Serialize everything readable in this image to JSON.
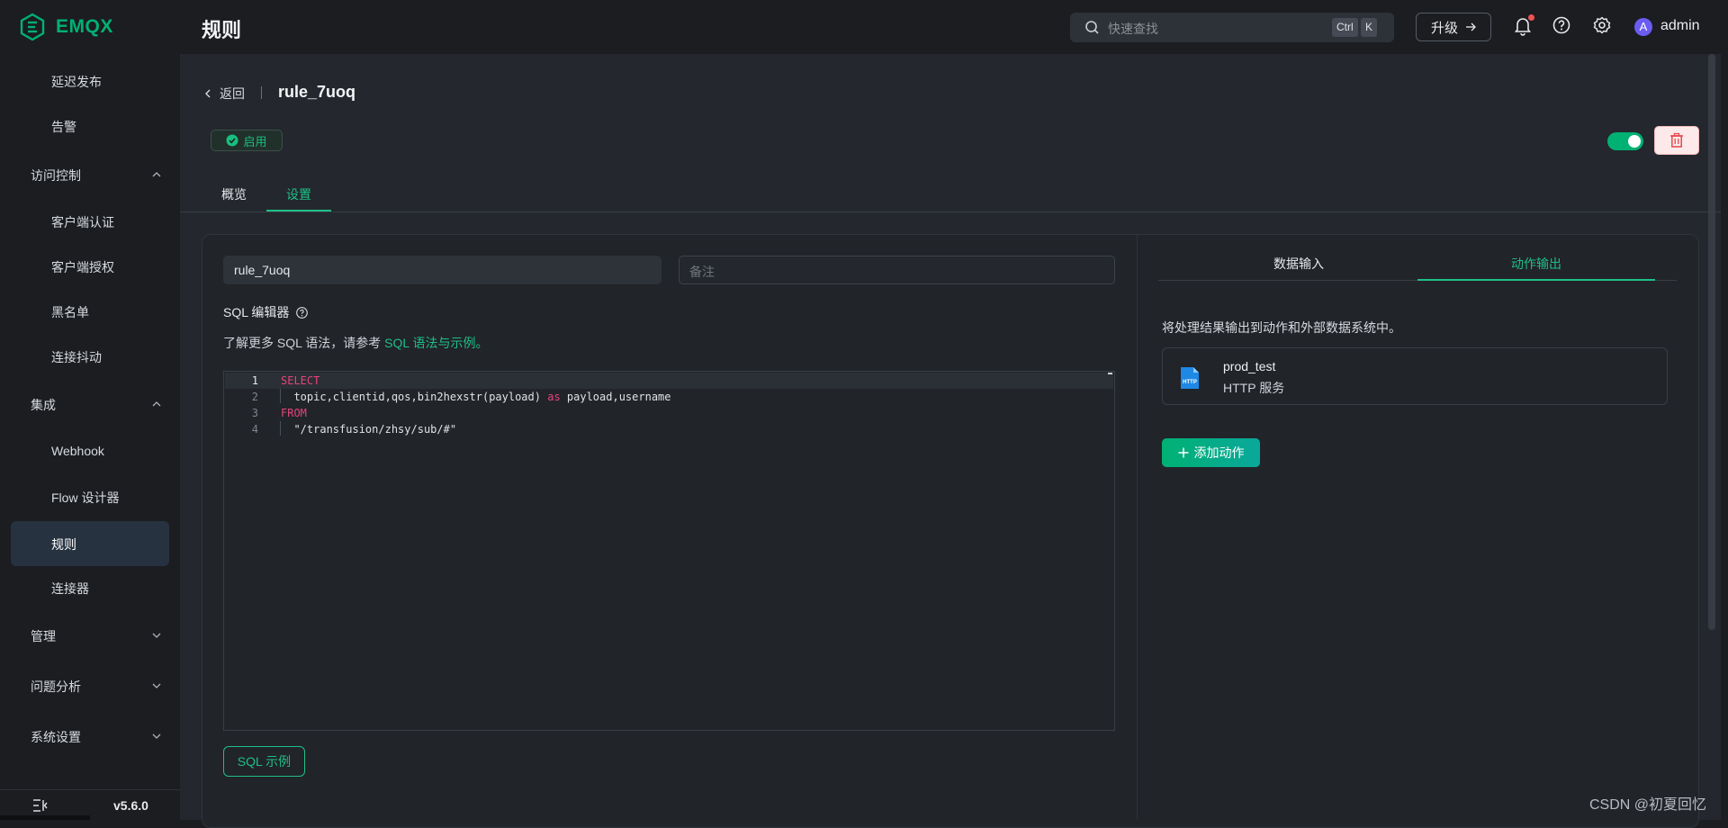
{
  "header": {
    "logo_text": "EMQX",
    "page_title": "规则",
    "search": {
      "placeholder": "快速查找",
      "shortcut_ctrl": "Ctrl",
      "shortcut_key": "K"
    },
    "upgrade_label": "升级",
    "user": {
      "avatar_letter": "A",
      "name": "admin"
    },
    "icons": [
      "search-icon",
      "arrow-right-icon",
      "bell-icon",
      "help-icon",
      "gear-icon"
    ]
  },
  "sidebar": {
    "items": [
      {
        "label": "延迟发布",
        "level": "sub"
      },
      {
        "label": "告警",
        "level": "sub"
      },
      {
        "label": "访问控制",
        "level": "group",
        "expanded": true
      },
      {
        "label": "客户端认证",
        "level": "sub"
      },
      {
        "label": "客户端授权",
        "level": "sub"
      },
      {
        "label": "黑名单",
        "level": "sub"
      },
      {
        "label": "连接抖动",
        "level": "sub"
      },
      {
        "label": "集成",
        "level": "group",
        "expanded": true
      },
      {
        "label": "Webhook",
        "level": "sub"
      },
      {
        "label": "Flow 设计器",
        "level": "sub"
      },
      {
        "label": "规则",
        "level": "sub",
        "active": true
      },
      {
        "label": "连接器",
        "level": "sub"
      },
      {
        "label": "管理",
        "level": "group",
        "expanded": false
      },
      {
        "label": "问题分析",
        "level": "group",
        "expanded": false
      },
      {
        "label": "系统设置",
        "level": "group",
        "expanded": false
      }
    ],
    "version": "v5.6.0"
  },
  "rule": {
    "back_label": "返回",
    "title": "rule_7uoq",
    "status": "启用",
    "enabled": true
  },
  "tabs": [
    {
      "label": "概览",
      "active": false
    },
    {
      "label": "设置",
      "active": true
    }
  ],
  "form": {
    "name_value": "rule_7uoq",
    "note_placeholder": "备注",
    "sql_label": "SQL 编辑器",
    "sql_help_prefix": "了解更多 SQL 语法，请参考",
    "sql_help_link": "SQL 语法与示例。",
    "sql_example_button": "SQL 示例"
  },
  "editor": {
    "lines": [
      {
        "num": "1",
        "text": "SELECT"
      },
      {
        "num": "2",
        "text": "  topic,clientid,qos,bin2hexstr(payload) as payload,username"
      },
      {
        "num": "3",
        "text": "FROM"
      },
      {
        "num": "4",
        "text": "  \"/transfusion/zhsy/sub/#\""
      }
    ]
  },
  "right_panel": {
    "tabs": [
      {
        "label": "数据输入",
        "active": false
      },
      {
        "label": "动作输出",
        "active": true
      }
    ],
    "description": "将处理结果输出到动作和外部数据系统中。",
    "actions": [
      {
        "name": "prod_test",
        "type": "HTTP 服务"
      }
    ],
    "add_action_label": "添加动作"
  },
  "watermark": "CSDN @初夏回忆",
  "colors": {
    "accent": "#00b173",
    "background": "#1b1d21",
    "panel": "#24272d",
    "danger": "#e5484d",
    "sql_keyword": "#e5457a"
  }
}
